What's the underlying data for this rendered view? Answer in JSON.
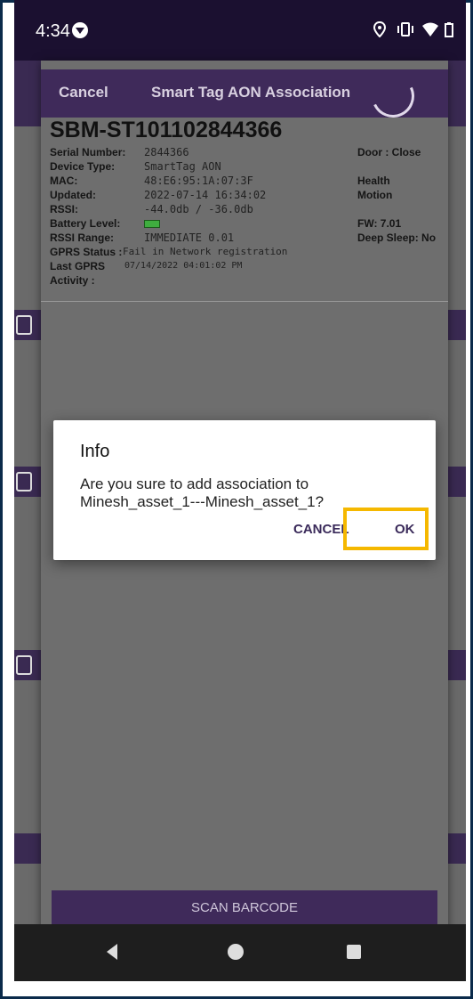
{
  "status_bar": {
    "time": "4:34"
  },
  "sheet": {
    "cancel_label": "Cancel",
    "title": "Smart Tag AON Association",
    "device_name": "SBM-ST101102844366",
    "fields": [
      {
        "label": "Serial Number:",
        "value": "2844366"
      },
      {
        "label": "Device Type:",
        "value": "SmartTag AON"
      },
      {
        "label": "MAC:",
        "value": "48:E6:95:1A:07:3F"
      },
      {
        "label": "Updated:",
        "value": "2022-07-14 16:34:02"
      },
      {
        "label": "RSSI:",
        "value": "-44.0db / -36.0db"
      },
      {
        "label": "Battery Level:",
        "value": ""
      },
      {
        "label": "RSSI Range:",
        "value": "IMMEDIATE 0.01"
      },
      {
        "label": "GPRS Status :",
        "value": "Fail in Network registration"
      },
      {
        "label": "Last GPRS",
        "value": "07/14/2022 04:01:02 PM"
      },
      {
        "label": "Activity :",
        "value": ""
      }
    ],
    "right_fields": [
      "Door : Close",
      "Health",
      "Motion",
      "FW: 7.01",
      "Deep Sleep: No"
    ],
    "scan_barcode_label": "SCAN BARCODE"
  },
  "dialog": {
    "title": "Info",
    "message": "Are you sure to add association to Minesh_asset_1---Minesh_asset_1?",
    "cancel_label": "CANCEL",
    "ok_label": "OK"
  },
  "colors": {
    "accent": "#3f2a5a",
    "highlight": "#f5b800"
  },
  "icons": [
    "location-icon",
    "vibrate-icon",
    "wifi-icon",
    "battery-icon",
    "back-icon",
    "home-icon",
    "recents-icon"
  ]
}
